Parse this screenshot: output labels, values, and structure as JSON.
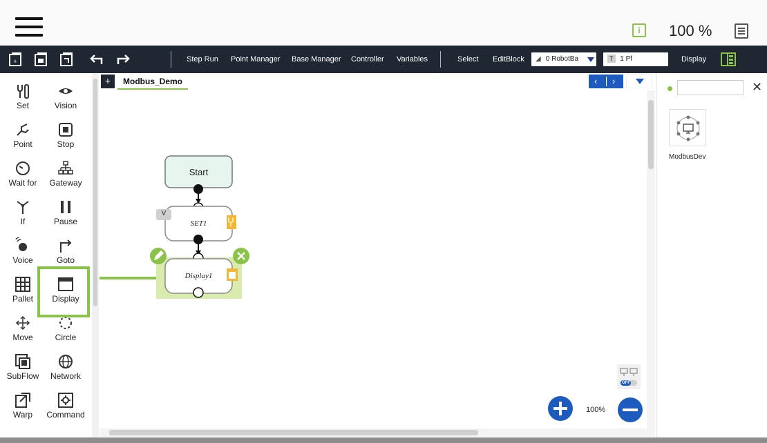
{
  "topbar": {
    "zoom": "100 %"
  },
  "toolbar": {
    "step_run": "Step Run",
    "point_manager": "Point Manager",
    "base_manager": "Base Manager",
    "controller": "Controller",
    "variables": "Variables",
    "select": "Select",
    "edit_block": "EditBlock",
    "base_select": "0 RobotBa",
    "tool_badge": "T",
    "tool_select": "1 Pf",
    "display": "Display"
  },
  "palette": {
    "items": [
      {
        "label": "Set",
        "icon": "set-icon"
      },
      {
        "label": "Vision",
        "icon": "eye-icon"
      },
      {
        "label": "Point",
        "icon": "point-icon"
      },
      {
        "label": "Stop",
        "icon": "stop-icon"
      },
      {
        "label": "Wait for",
        "icon": "clock-icon"
      },
      {
        "label": "Gateway",
        "icon": "gateway-icon"
      },
      {
        "label": "If",
        "icon": "if-icon"
      },
      {
        "label": "Pause",
        "icon": "pause-icon"
      },
      {
        "label": "Voice",
        "icon": "voice-icon"
      },
      {
        "label": "Goto",
        "icon": "goto-arrow-icon"
      },
      {
        "label": "Pallet",
        "icon": "pallet-grid-icon"
      },
      {
        "label": "Display",
        "icon": "display-icon"
      },
      {
        "label": "Move",
        "icon": "move-icon"
      },
      {
        "label": "Circle",
        "icon": "circle-icon"
      },
      {
        "label": "SubFlow",
        "icon": "subflow-icon"
      },
      {
        "label": "Network",
        "icon": "globe-icon"
      },
      {
        "label": "Warp",
        "icon": "warp-icon"
      },
      {
        "label": "Command",
        "icon": "command-icon"
      }
    ]
  },
  "tabs": {
    "add": "+",
    "project": "Modbus_Demo"
  },
  "flow": {
    "nodes": [
      {
        "label": "Start"
      },
      {
        "label": "SET1",
        "badge": "V"
      },
      {
        "label": "Display1"
      }
    ]
  },
  "canvas": {
    "zoom": "100%",
    "toggle_state": "OFF"
  },
  "right_panel": {
    "search_value": "",
    "devices": [
      {
        "label": "ModbusDev",
        "icon": "network-device-icon"
      }
    ]
  },
  "colors": {
    "toolbar_bg": "#1f2733",
    "accent_green": "#8bc34a",
    "accent_blue": "#1e5bbf",
    "start_node_fill": "#e6f6ee",
    "selection_fill": "#d9ecae",
    "node_icon_orange": "#f5b731"
  }
}
